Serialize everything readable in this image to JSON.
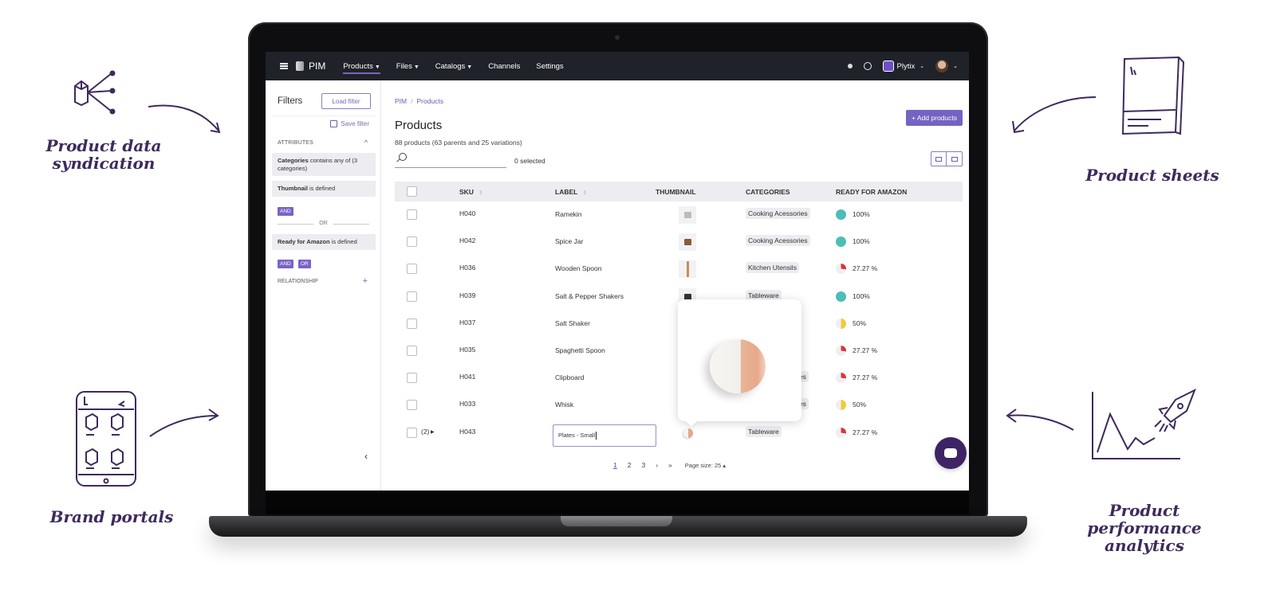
{
  "annotations": {
    "syndication": "Product data syndication",
    "sheets": "Product sheets",
    "portals": "Brand portals",
    "analytics": "Product performance analytics"
  },
  "topbar": {
    "app_name": "PIM",
    "nav": [
      {
        "label": "Products",
        "caret": true,
        "active": true
      },
      {
        "label": "Files",
        "caret": true
      },
      {
        "label": "Catalogs",
        "caret": true
      },
      {
        "label": "Channels"
      },
      {
        "label": "Settings"
      }
    ],
    "org_name": "Plytix"
  },
  "sidebar": {
    "title": "Filters",
    "load_filter": "Load filter",
    "save_filter": "Save filter",
    "attributes_heading": "ATTRIBUTES",
    "filters": [
      {
        "attr": "Categories",
        "rest": " contains any of (3 categories)"
      },
      {
        "attr": "Thumbnail",
        "rest": " is defined"
      },
      {
        "attr": "Ready for Amazon",
        "rest": " is defined"
      }
    ],
    "and_label": "AND",
    "or_label": "OR",
    "or_divider": "OR",
    "relationship_heading": "RELATIONSHIP",
    "collapse": "‹"
  },
  "main": {
    "breadcrumb": [
      "PIM",
      "Products"
    ],
    "title": "Products",
    "count": "88 products (63 parents and 25 variations)",
    "search_placeholder": "",
    "selected": "0 selected",
    "add_button": "+ Add products",
    "columns": [
      "SKU",
      "LABEL",
      "THUMBNAIL",
      "CATEGORIES",
      "READY FOR AMAZON"
    ],
    "rows": [
      {
        "sku": "H040",
        "label": "Ramekin",
        "category": "Cooking Acessories",
        "ready": "100%",
        "ready_value": 1.0,
        "color": "#4dbdb8"
      },
      {
        "sku": "H042",
        "label": "Spice Jar",
        "category": "Cooking Acessories",
        "ready": "100%",
        "ready_value": 1.0,
        "color": "#4dbdb8"
      },
      {
        "sku": "H036",
        "label": "Wooden Spoon",
        "category": "Kitchen Utensils",
        "ready": "27.27 %",
        "ready_value": 0.2727,
        "color": "#d8363a"
      },
      {
        "sku": "H039",
        "label": "Salt & Pepper Shakers",
        "category": "Tableware",
        "ready": "100%",
        "ready_value": 1.0,
        "color": "#4dbdb8"
      },
      {
        "sku": "H037",
        "label": "Salt Shaker",
        "category": "",
        "ready": "50%",
        "ready_value": 0.5,
        "color": "#f5c83a"
      },
      {
        "sku": "H035",
        "label": "Spaghetti Spoon",
        "category": "",
        "ready": "27.27 %",
        "ready_value": 0.2727,
        "color": "#d8363a"
      },
      {
        "sku": "H041",
        "label": "Clipboard",
        "category": "ies",
        "ready": "27.27 %",
        "ready_value": 0.2727,
        "color": "#d8363a"
      },
      {
        "sku": "H033",
        "label": "Whisk",
        "category": "ies",
        "ready": "50%",
        "ready_value": 0.5,
        "color": "#f5c83a"
      },
      {
        "sku": "H043",
        "label": "Plates - Small",
        "category": "Tableware",
        "ready": "27.27 %",
        "ready_value": 0.2727,
        "color": "#d8363a",
        "variations": "(2)",
        "editing": true
      }
    ],
    "pagination": {
      "pages": [
        "1",
        "2",
        "3"
      ],
      "current": "1",
      "next": "›",
      "last": "»",
      "page_size": "Page size: 25 ▴"
    }
  }
}
